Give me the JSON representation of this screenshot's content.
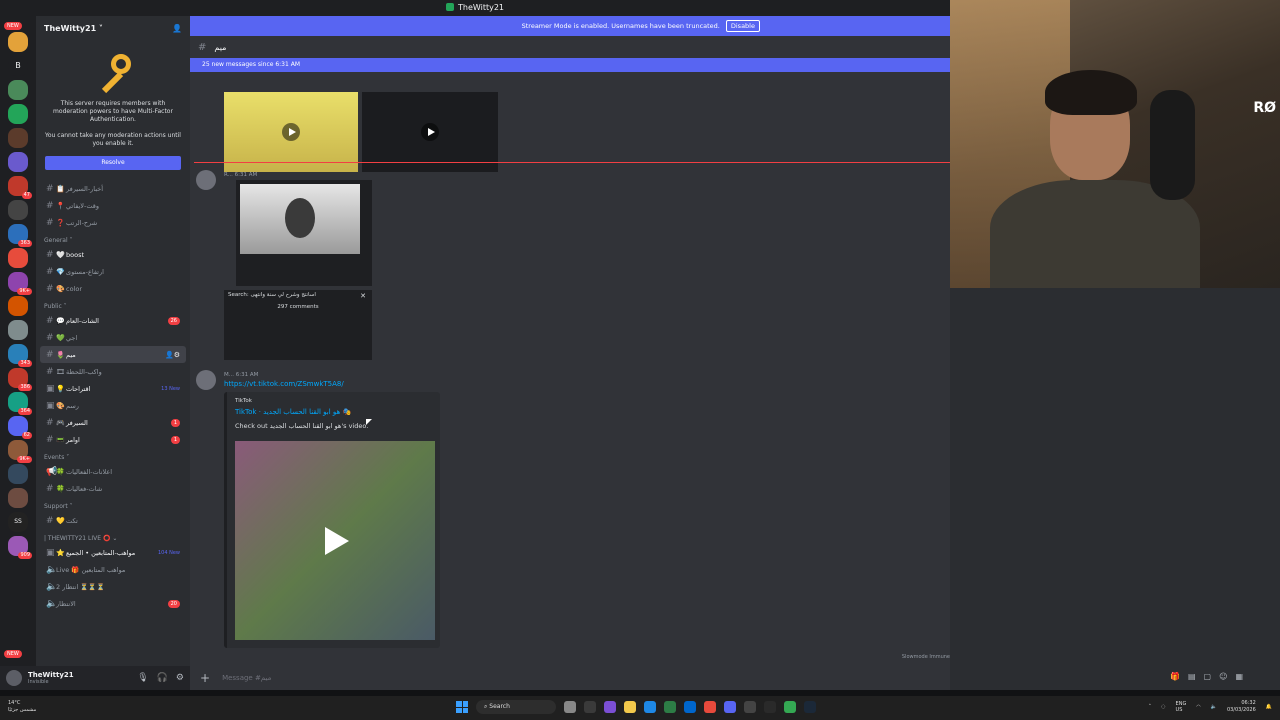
{
  "window": {
    "title": "TheWitty21"
  },
  "banner": {
    "text": "Streamer Mode is enabled. Usernames have been truncated.",
    "disable_label": "Disable"
  },
  "servers": {
    "new_label": "NEW",
    "letter": "B",
    "badges": [
      "47",
      "363",
      "9K+",
      "343",
      "386",
      "364",
      "62",
      "9K+",
      "SS",
      "909",
      "NEW"
    ]
  },
  "guild": {
    "name": "TheWitty21 ˅"
  },
  "mfa": {
    "text1": "This server requires members with moderation powers to have Multi-Factor Authentication.",
    "text2": "You cannot take any moderation actions until you enable it.",
    "resolve_label": "Resolve"
  },
  "channels": {
    "top": [
      {
        "label": "أخبار-السيرفر",
        "emoji": "📋"
      },
      {
        "label": "وقت-لايفاتي",
        "emoji": "📍"
      },
      {
        "label": "شرح-الرتب",
        "emoji": "❓"
      }
    ],
    "general_cat": "General ˅",
    "general": [
      {
        "label": "boost",
        "emoji": "🤍"
      },
      {
        "label": "ارتفاع-مستوى",
        "emoji": "💎"
      },
      {
        "label": "color",
        "emoji": "🎨"
      }
    ],
    "public_cat": "Public ˅",
    "public": [
      {
        "label": "الشات-العام",
        "emoji": "💬",
        "count": "26"
      },
      {
        "label": "اجي",
        "emoji": "💚"
      },
      {
        "label": "ميم",
        "emoji": "🌷",
        "active": true
      },
      {
        "label": "واكب-اللحظة",
        "emoji": "🎞"
      },
      {
        "label": "اقتراحات",
        "emoji": "💡",
        "newtag": "13 New"
      },
      {
        "label": "رسم",
        "emoji": "🎨"
      },
      {
        "label": "السيرفر",
        "emoji": "🎮",
        "count": "1"
      },
      {
        "label": "اوامر",
        "emoji": "📟",
        "count": "1"
      }
    ],
    "events_cat": "Events ˅",
    "events": [
      {
        "label": "اعلانات-الفعاليات",
        "emoji": "🍀"
      },
      {
        "label": "شات-فعاليات",
        "emoji": "🍀"
      }
    ],
    "support_cat": "Support ˅",
    "support": [
      {
        "label": "تكت",
        "emoji": "💛"
      }
    ],
    "live_cat": "| THEWITTY21 LIVE ⭕ ⌄",
    "live": [
      {
        "label": "مواهب-المتابعين • الجميع",
        "emoji": "⭐",
        "newtag": "104 New"
      },
      {
        "label": "Live 🎁 مواهب المتابعين",
        "emoji": "🔊"
      },
      {
        "label": "انتظار 2 ⏳⏳⏳",
        "emoji": "🔊"
      },
      {
        "label": "الانتظار",
        "emoji": "🔊",
        "count": "20"
      }
    ]
  },
  "user": {
    "name": "TheWitty21",
    "status": "Invisible"
  },
  "chat": {
    "channel_name": "ميم",
    "new_messages": "25 new messages since 6:31 AM",
    "msg1_author": "R...",
    "msg1_time": "6:31 AM",
    "search_label": "Search: اسانتج وشرح لي سنة وانتهى",
    "comments": "297 comments",
    "msg2_author": "M...",
    "msg2_time": "6:31 AM",
    "link": "https://vt.tiktok.com/ZSmwkT5A8/",
    "embed_provider": "TikTok",
    "embed_title": "TikTok · هو ابو القنا الحساب الجديد 🎭",
    "embed_desc": "Check out هو ابو القنا الحساب الجديد's video.",
    "composer_placeholder": "Message #ميم",
    "slowmode": "Slowmode Immune"
  },
  "taskbar": {
    "weather_temp": "14°C",
    "weather_desc": "مشمس جزئيًا",
    "search": "Search",
    "lang": "ENG",
    "region": "US",
    "time": "06:32",
    "date": "03/03/2026"
  },
  "cam": {
    "brand": "RØ"
  }
}
